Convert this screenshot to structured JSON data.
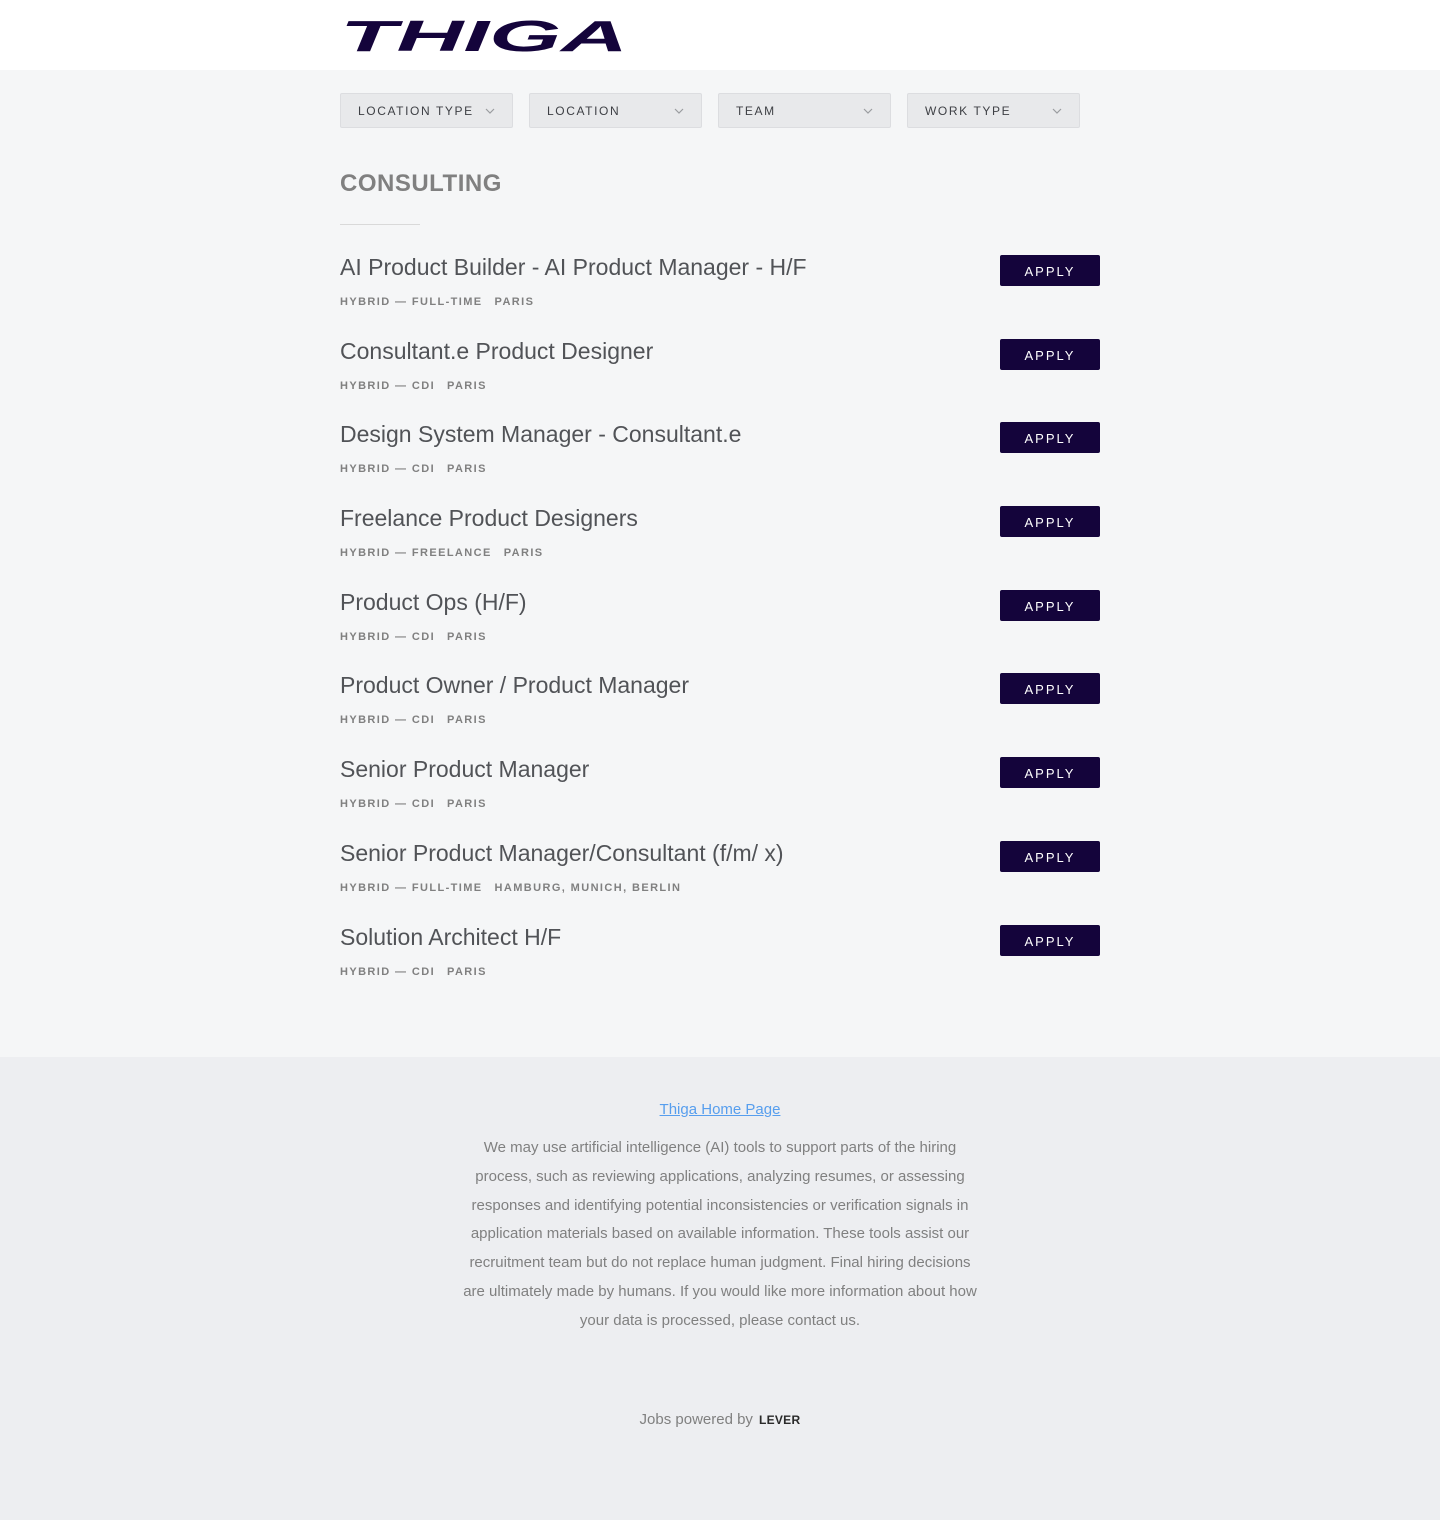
{
  "brand": {
    "name": "THIGA",
    "color": "#14043b"
  },
  "filters": [
    {
      "label": "LOCATION TYPE",
      "icon": "chevron-down-icon"
    },
    {
      "label": "LOCATION",
      "icon": "chevron-down-icon"
    },
    {
      "label": "TEAM",
      "icon": "chevron-down-icon"
    },
    {
      "label": "WORK TYPE",
      "icon": "chevron-down-icon"
    }
  ],
  "category": {
    "title": "CONSULTING"
  },
  "postings": [
    {
      "title": "AI Product Builder - AI Product Manager - H/F",
      "commitment": "HYBRID — FULL-TIME",
      "location": "PARIS",
      "apply_label": "APPLY"
    },
    {
      "title": "Consultant.e Product Designer",
      "commitment": "HYBRID — CDI",
      "location": "PARIS",
      "apply_label": "APPLY"
    },
    {
      "title": "Design System Manager - Consultant.e",
      "commitment": "HYBRID — CDI",
      "location": "PARIS",
      "apply_label": "APPLY"
    },
    {
      "title": "Freelance Product Designers",
      "commitment": "HYBRID — FREELANCE",
      "location": "PARIS",
      "apply_label": "APPLY"
    },
    {
      "title": "Product Ops (H/F)",
      "commitment": "HYBRID — CDI",
      "location": "PARIS",
      "apply_label": "APPLY"
    },
    {
      "title": "Product Owner / Product Manager",
      "commitment": "HYBRID — CDI",
      "location": "PARIS",
      "apply_label": "APPLY"
    },
    {
      "title": "Senior Product Manager",
      "commitment": "HYBRID — CDI",
      "location": "PARIS",
      "apply_label": "APPLY"
    },
    {
      "title": "Senior Product Manager/Consultant (f/m/ x)",
      "commitment": "HYBRID — FULL-TIME",
      "location": "HAMBURG, MUNICH, BERLIN",
      "apply_label": "APPLY"
    },
    {
      "title": "Solution Architect H/F",
      "commitment": "HYBRID — CDI",
      "location": "PARIS",
      "apply_label": "APPLY"
    }
  ],
  "footer": {
    "home_link": "Thiga Home Page",
    "disclaimer": "We may use artificial intelligence (AI) tools to support parts of the hiring process, such as reviewing applications, analyzing resumes, or assessing responses and identifying potential inconsistencies or verification signals in application materials based on available information. These tools assist our recruitment team but do not replace human judgment. Final hiring decisions are ultimately made by humans. If you would like more information about how your data is processed, please contact us.",
    "powered_by": "Jobs powered by",
    "powered_brand": "LEVER",
    "link_color": "#579eee"
  }
}
